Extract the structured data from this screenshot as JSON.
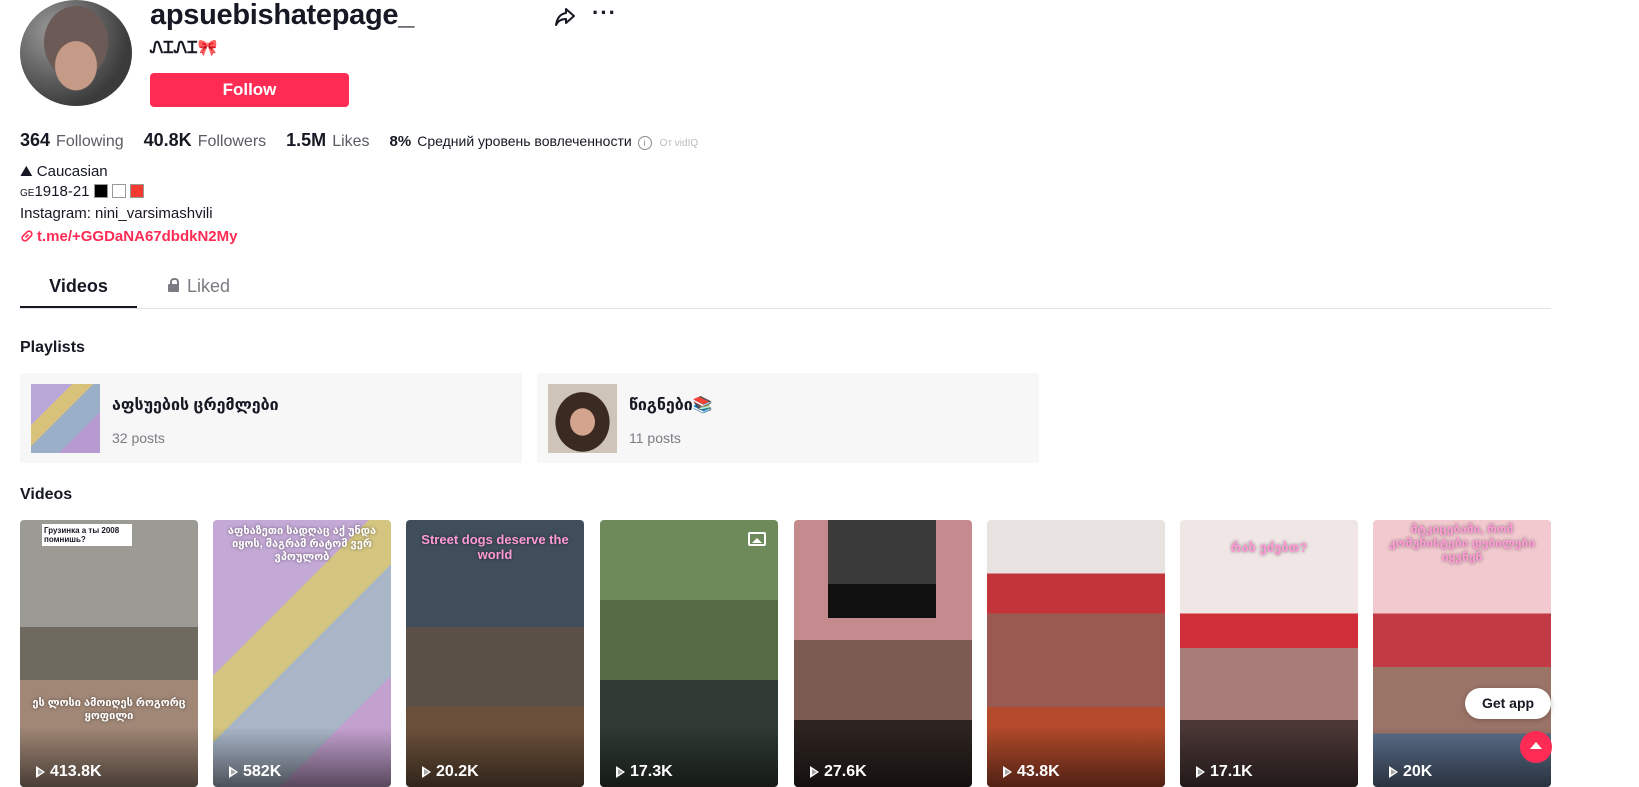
{
  "profile": {
    "username": "apsuebishatepage_",
    "nickname": "ᏁᏆᏁᏆ🎀",
    "follow_label": "Follow"
  },
  "stats": {
    "following_count": "364",
    "following_label": "Following",
    "followers_count": "40.8K",
    "followers_label": "Followers",
    "likes_count": "1.5M",
    "likes_label": "Likes",
    "engagement_value": "8%",
    "engagement_label": "Средний уровень вовлеченности",
    "engagement_source": "От vidIQ"
  },
  "bio": {
    "line1": "⛰ Caucasian",
    "line2_prefix": "GE",
    "line2": "1918-21",
    "line3": "Instagram: nini_varsimashvili",
    "link": "t.me/+GGDaNA67dbdkN2My",
    "flag_colors": [
      "#000000",
      "#ffffff",
      "#f23a2e"
    ]
  },
  "tabs": {
    "videos": "Videos",
    "liked": "Liked"
  },
  "sections": {
    "playlists_title": "Playlists",
    "videos_title": "Videos"
  },
  "playlists": [
    {
      "name": "აფსუების ცრემლები",
      "count": "32 posts"
    },
    {
      "name": "წიგნები📚",
      "count": "11 posts"
    }
  ],
  "videos": [
    {
      "views": "413.8K",
      "caption": "ეს ლოსი ამოიღეს როგორც ყოფილი",
      "top_caption": "Грузинка а ты 2008 помнишь?"
    },
    {
      "views": "582K",
      "caption": "აფხაზეთი სადღაც აქ უნდა იყოს, მაგრამ რატომ ვერ ვპოულობ"
    },
    {
      "views": "20.2K",
      "caption": "Street dogs deserve the world"
    },
    {
      "views": "17.3K",
      "caption": ""
    },
    {
      "views": "27.6K",
      "caption": ""
    },
    {
      "views": "43.8K",
      "caption": ""
    },
    {
      "views": "17.1K",
      "caption": "რას ეძებთ?"
    },
    {
      "views": "20K",
      "caption": "მტკიცებაში, რომ კომუნისტები დებილები იყვნენ"
    }
  ],
  "buttons": {
    "get_app": "Get app"
  },
  "colors": {
    "accent": "#fe2c55"
  },
  "icons": [
    "share-icon",
    "more-icon",
    "info-icon",
    "link-icon",
    "lock-icon",
    "play-icon",
    "photo-icon",
    "scroll-top-icon"
  ]
}
